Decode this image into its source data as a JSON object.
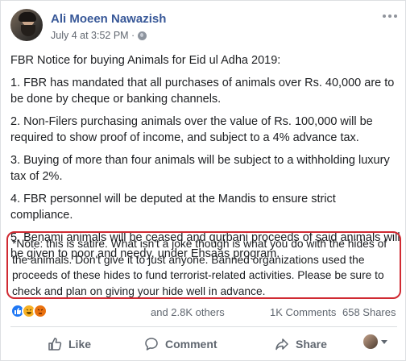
{
  "post": {
    "author": "Ali Moeen Nawazish",
    "timestamp": "July 4 at 3:52 PM · ",
    "audience_icon": "globe-icon",
    "paragraphs": [
      "FBR Notice for buying Animals for Eid ul Adha 2019:",
      "1. FBR has mandated that all purchases of animals over Rs. 40,000 are to be done by cheque or banking channels.",
      "2. Non-Filers purchasing animals over the value of Rs. 100,000 will be required to show proof of income, and subject to a 4% advance tax.",
      "3. Buying of more than four animals will be subject to a withholding luxury tax of 2%.",
      "4. FBR personnel will be deputed at the Mandis to ensure strict compliance.",
      "5. Benami animals will be ceased and qurbani proceeds of said animals will be given to poor and needy, under Ehsaas program."
    ],
    "note": "*Note: this is satire. What isn't a joke though is what you do with the hides of the animals. Don't give it to just anyone. Banned organizations used the proceeds of these hides to fund terrorist-related activities. Please be sure to check and plan on giving your hide well in advance."
  },
  "stats": {
    "reactions": [
      "like-reaction-icon",
      "haha-reaction-icon",
      "angry-reaction-icon"
    ],
    "others": "and 2.8K others",
    "comments": "1K Comments",
    "shares": "658 Shares"
  },
  "actions": {
    "like": "Like",
    "comment": "Comment",
    "share": "Share"
  },
  "colors": {
    "author_link": "#385898",
    "note_border": "#d02a32",
    "like_blue": "#2078f4"
  }
}
